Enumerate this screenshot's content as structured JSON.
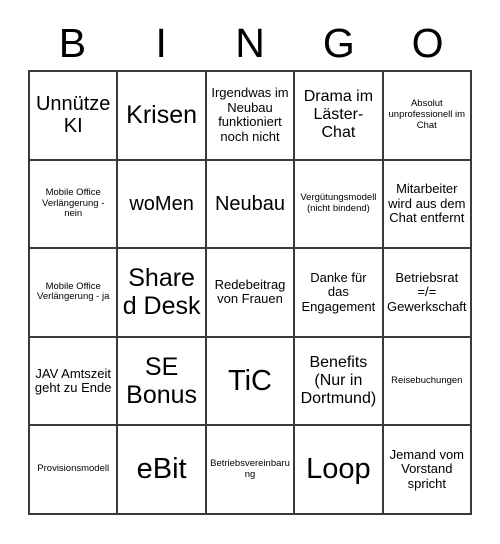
{
  "card": {
    "type": "bingo-card",
    "columns": 5,
    "rows": 5,
    "header_letters": [
      "B",
      "I",
      "N",
      "G",
      "O"
    ],
    "colors": {
      "background": "#ffffff",
      "text": "#000000",
      "grid_line": "#3a3a3a"
    },
    "cells": [
      {
        "text": "Unnütze KI",
        "size": "lg"
      },
      {
        "text": "Krisen",
        "size": "xl"
      },
      {
        "text": "Irgendwas im Neubau funktioniert noch nicht",
        "size": "sm"
      },
      {
        "text": "Drama im Läster-Chat",
        "size": "md"
      },
      {
        "text": "Absolut unprofessionell im Chat",
        "size": "xs"
      },
      {
        "text": "Mobile Office Verlängerung - nein",
        "size": "xs"
      },
      {
        "text": "woMen",
        "size": "lg"
      },
      {
        "text": "Neubau",
        "size": "lg"
      },
      {
        "text": "Vergütungsmodell (nicht bindend)",
        "size": "xs"
      },
      {
        "text": "Mitarbeiter wird aus dem Chat entfernt",
        "size": "sm"
      },
      {
        "text": "Mobile Office Verlängerung - ja",
        "size": "xs"
      },
      {
        "text": "Shared Desk",
        "size": "xl"
      },
      {
        "text": "Redebeitrag von Frauen",
        "size": "sm"
      },
      {
        "text": "Danke für das Engagement",
        "size": "sm"
      },
      {
        "text": "Betriebsrat =/= Gewerkschaft",
        "size": "sm"
      },
      {
        "text": "JAV Amtszeit geht zu Ende",
        "size": "sm"
      },
      {
        "text": "SE Bonus",
        "size": "xl"
      },
      {
        "text": "TiC",
        "size": "xxl"
      },
      {
        "text": "Benefits (Nur in Dortmund)",
        "size": "md"
      },
      {
        "text": "Reisebuchungen",
        "size": "xs"
      },
      {
        "text": "Provisionsmodell",
        "size": "xs"
      },
      {
        "text": "eBit",
        "size": "xxl"
      },
      {
        "text": "Betriebsvereinbarung",
        "size": "xs"
      },
      {
        "text": "Loop",
        "size": "xxl"
      },
      {
        "text": "Jemand vom Vorstand spricht",
        "size": "sm"
      }
    ]
  }
}
